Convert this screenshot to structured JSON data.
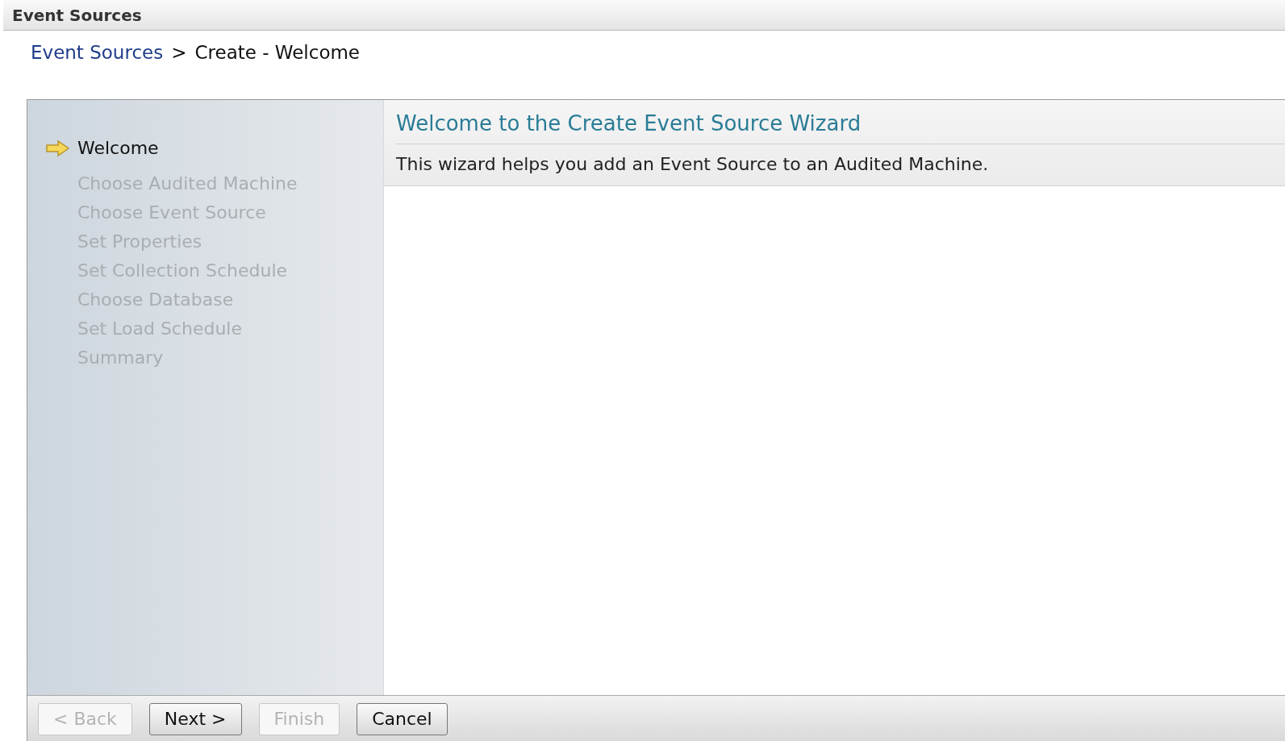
{
  "header": {
    "title": "Event Sources"
  },
  "breadcrumb": {
    "link": "Event Sources",
    "separator": ">",
    "current": "Create - Welcome"
  },
  "steps": [
    {
      "label": "Welcome",
      "selected": true
    },
    {
      "label": "Choose Audited Machine",
      "selected": false
    },
    {
      "label": "Choose Event Source",
      "selected": false
    },
    {
      "label": "Set Properties",
      "selected": false
    },
    {
      "label": "Set Collection Schedule",
      "selected": false
    },
    {
      "label": "Choose Database",
      "selected": false
    },
    {
      "label": "Set Load Schedule",
      "selected": false
    },
    {
      "label": "Summary",
      "selected": false
    }
  ],
  "content": {
    "title": "Welcome to the Create Event Source Wizard",
    "description": "This wizard helps you add an Event Source to an Audited Machine."
  },
  "buttons": [
    {
      "label": "< Back",
      "disabled": true
    },
    {
      "label": "Next >",
      "disabled": false
    },
    {
      "label": "Finish",
      "disabled": true
    },
    {
      "label": "Cancel",
      "disabled": false
    }
  ]
}
